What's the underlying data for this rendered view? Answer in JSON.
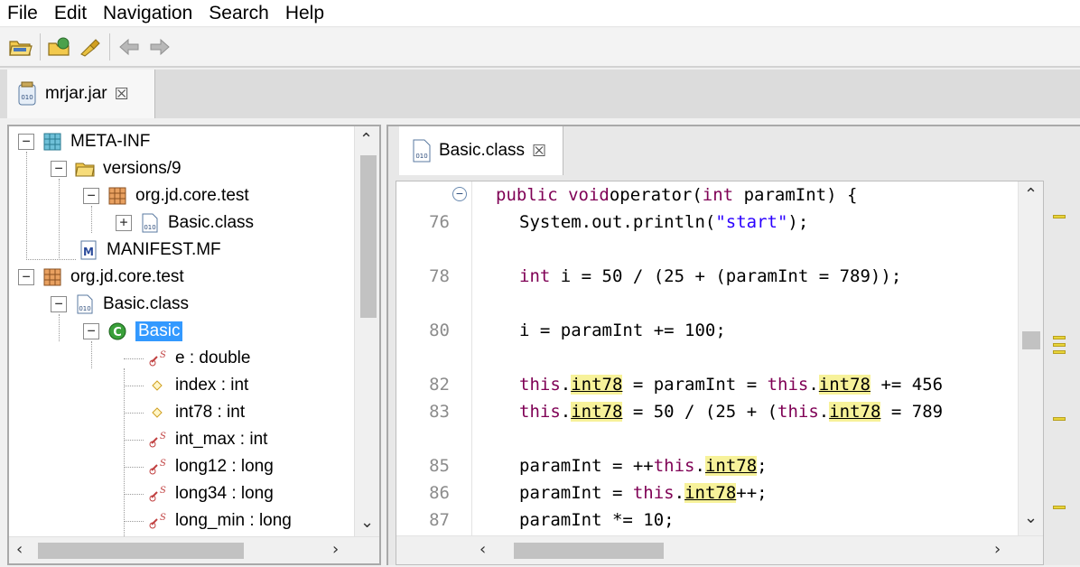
{
  "menu": [
    "File",
    "Edit",
    "Navigation",
    "Search",
    "Help"
  ],
  "toolbar": {
    "icons": [
      "open-file-icon",
      "open-type-icon",
      "pin-icon",
      "back-arrow-icon",
      "forward-arrow-icon"
    ]
  },
  "jar_tab": {
    "label": "mrjar.jar",
    "close": "☒"
  },
  "tree": {
    "items": [
      {
        "label": "META-INF",
        "icon": "package-folder-icon",
        "expander": "−"
      },
      {
        "label": "versions/9",
        "icon": "folder-icon",
        "expander": "−"
      },
      {
        "label": "org.jd.core.test",
        "icon": "package-icon",
        "expander": "−"
      },
      {
        "label": "Basic.class",
        "icon": "class-file-icon",
        "expander": "+"
      },
      {
        "label": "MANIFEST.MF",
        "icon": "manifest-icon"
      },
      {
        "label": "org.jd.core.test",
        "icon": "package-icon",
        "expander": "−"
      },
      {
        "label": "Basic.class",
        "icon": "class-file-icon",
        "expander": "−"
      },
      {
        "label": "Basic",
        "icon": "class-icon",
        "expander": "−",
        "selected": true
      },
      {
        "label": "e : double",
        "icon": "static-field-icon"
      },
      {
        "label": "index : int",
        "icon": "field-icon"
      },
      {
        "label": "int78 : int",
        "icon": "field-icon"
      },
      {
        "label": "int_max : int",
        "icon": "static-field-icon"
      },
      {
        "label": "long12 : long",
        "icon": "static-field-icon"
      },
      {
        "label": "long34 : long",
        "icon": "static-field-icon"
      },
      {
        "label": "long_min : long",
        "icon": "static-field-icon"
      }
    ]
  },
  "editor_tab": {
    "label": "Basic.class",
    "close": "☒"
  },
  "editor": {
    "line_numbers": [
      "76",
      "78",
      "80",
      "82",
      "83",
      "85",
      "86",
      "87"
    ],
    "lines": [
      {
        "parts": [
          [
            "kw",
            "public void"
          ],
          [
            "",
            "operator("
          ],
          [
            "kw",
            "int"
          ],
          [
            "",
            " paramInt) {"
          ]
        ]
      },
      {
        "parts": [
          [
            "",
            "System.out.println("
          ],
          [
            "str",
            "\"start\""
          ],
          [
            "",
            ");"
          ]
        ]
      },
      {
        "parts": [
          [
            "kw",
            "int"
          ],
          [
            "",
            " i = 50 / (25 + (paramInt = 789));"
          ]
        ]
      },
      {
        "parts": [
          [
            "",
            "i = paramInt += 100;"
          ]
        ]
      },
      {
        "parts": [
          [
            "kw",
            "this"
          ],
          [
            "",
            "."
          ],
          [
            "hl",
            "int78"
          ],
          [
            "",
            " = paramInt = "
          ],
          [
            "kw",
            "this"
          ],
          [
            "",
            "."
          ],
          [
            "hl",
            "int78"
          ],
          [
            "",
            " += 456"
          ]
        ]
      },
      {
        "parts": [
          [
            "kw",
            "this"
          ],
          [
            "",
            "."
          ],
          [
            "hl",
            "int78"
          ],
          [
            "",
            " = 50 / (25 + ("
          ],
          [
            "kw",
            "this"
          ],
          [
            "",
            "."
          ],
          [
            "hl",
            "int78"
          ],
          [
            "",
            " = 789"
          ]
        ]
      },
      {
        "parts": [
          [
            "",
            "paramInt = ++"
          ],
          [
            "kw",
            "this"
          ],
          [
            "",
            "."
          ],
          [
            "hl",
            "int78"
          ],
          [
            "",
            ";"
          ]
        ]
      },
      {
        "parts": [
          [
            "",
            "paramInt = "
          ],
          [
            "kw",
            "this"
          ],
          [
            "",
            "."
          ],
          [
            "hl",
            "int78"
          ],
          [
            "",
            "++;"
          ]
        ]
      },
      {
        "parts": [
          [
            "",
            "paramInt *= 10;"
          ]
        ]
      }
    ]
  },
  "colors": {
    "keyword": "#7f0055",
    "string": "#2a00ff",
    "highlight": "#f7f29a",
    "selection": "#3399ff"
  }
}
